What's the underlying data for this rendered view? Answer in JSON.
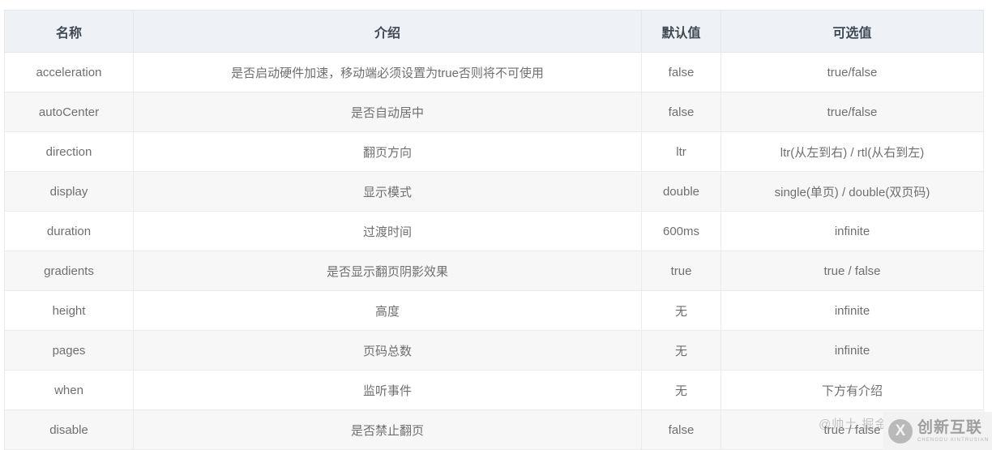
{
  "table": {
    "columns": [
      {
        "key": "name",
        "label": "名称"
      },
      {
        "key": "desc",
        "label": "介绍"
      },
      {
        "key": "default",
        "label": "默认值"
      },
      {
        "key": "options",
        "label": "可选值"
      }
    ],
    "rows": [
      {
        "name": "acceleration",
        "desc": "是否启动硬件加速，移动端必须设置为true否则将不可使用",
        "default": "false",
        "options": "true/false"
      },
      {
        "name": "autoCenter",
        "desc": "是否自动居中",
        "default": "false",
        "options": "true/false"
      },
      {
        "name": "direction",
        "desc": "翻页方向",
        "default": "ltr",
        "options": "ltr(从左到右) / rtl(从右到左)"
      },
      {
        "name": "display",
        "desc": "显示模式",
        "default": "double",
        "options": "single(单页) / double(双页码)"
      },
      {
        "name": "duration",
        "desc": "过渡时间",
        "default": "600ms",
        "options": "infinite"
      },
      {
        "name": "gradients",
        "desc": "是否显示翻页阴影效果",
        "default": "true",
        "options": "true / false"
      },
      {
        "name": "height",
        "desc": "高度",
        "default": "无",
        "options": "infinite"
      },
      {
        "name": "pages",
        "desc": "页码总数",
        "default": "无",
        "options": "infinite"
      },
      {
        "name": "when",
        "desc": "监听事件",
        "default": "无",
        "options": "下方有介绍"
      },
      {
        "name": "disable",
        "desc": "是否禁止翻页",
        "default": "false",
        "options": "true / false"
      }
    ]
  },
  "watermark": {
    "faint_text": "@帅土 掘金",
    "logo_mark": "X",
    "logo_title": "创新互联",
    "logo_subtitle": "CHENGDU XINTRUSIAN"
  },
  "colors": {
    "header_bg": "#eef2f6",
    "header_text": "#3f4a54",
    "body_text": "#6f6f6f",
    "row_alt_bg": "#f7f7f7",
    "border": "#ebebeb"
  }
}
